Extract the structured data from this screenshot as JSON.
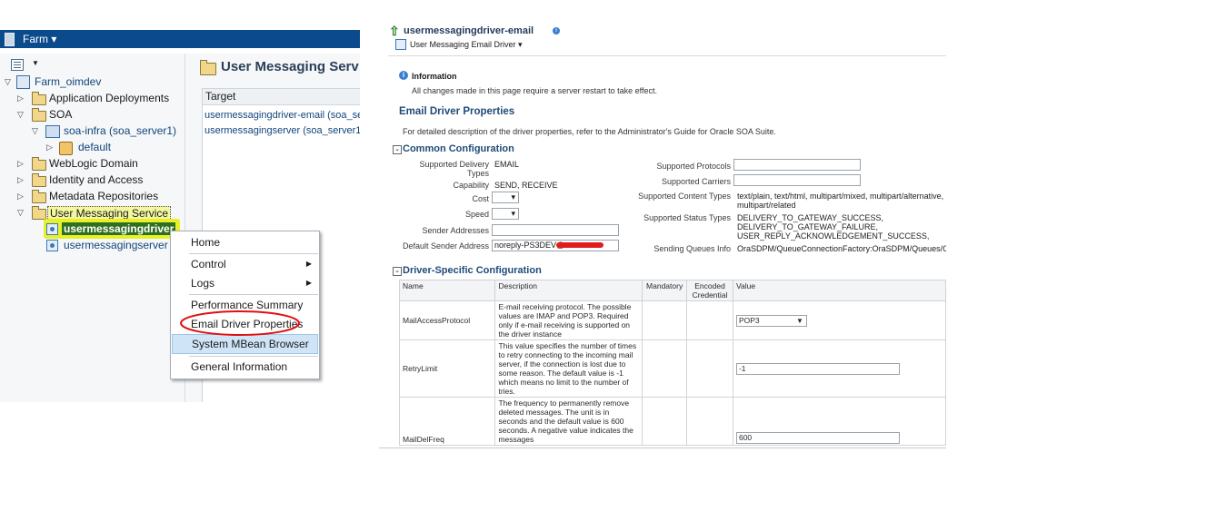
{
  "left_panel": {
    "farm_menu": "Farm",
    "tree": {
      "root": "Farm_oimdev",
      "items": [
        {
          "label": "Application Deployments"
        },
        {
          "label": "SOA"
        },
        {
          "label": "soa-infra (soa_server1)"
        },
        {
          "label": "default"
        },
        {
          "label": "WebLogic Domain"
        },
        {
          "label": "Identity and Access"
        },
        {
          "label": "Metadata Repositories"
        },
        {
          "label": "User Messaging Service"
        },
        {
          "label": "usermessagingdriver"
        },
        {
          "label": "usermessagingserver (s"
        }
      ]
    },
    "content_title": "User Messaging Serv",
    "table_header": "Target",
    "targets": [
      "usermessagingdriver-email (soa_se",
      "usermessagingserver (soa_server1)"
    ],
    "context_menu": {
      "items": [
        "Home",
        "Control",
        "Logs",
        "Performance Summary",
        "Email Driver Properties",
        "System MBean Browser",
        "General Information"
      ]
    }
  },
  "right_panel": {
    "title": "usermessagingdriver-email",
    "driver_menu": "User Messaging Email Driver",
    "info_heading": "Information",
    "info_text": "All changes made in this page require a server restart to take effect.",
    "page_heading": "Email Driver Properties",
    "page_desc": "For detailed description of the driver properties, refer to the Administrator's Guide for Oracle SOA Suite.",
    "common": {
      "heading": "Common Configuration",
      "delivery_label1": "Supported Delivery",
      "delivery_label2": "Types",
      "delivery_value": "EMAIL",
      "capability_label": "Capability",
      "capability_value": "SEND, RECEIVE",
      "cost_label": "Cost",
      "speed_label": "Speed",
      "sender_addresses_label": "Sender Addresses",
      "default_sender_label": "Default Sender Address",
      "default_sender_value": "noreply-PS3DEV@",
      "protocols_label": "Supported Protocols",
      "carriers_label": "Supported Carriers",
      "content_types_label": "Supported Content Types",
      "content_types_value1": "text/plain, text/html, multipart/mixed, multipart/alternative,",
      "content_types_value2": "multipart/related",
      "status_types_label": "Supported Status Types",
      "status_value1": "DELIVERY_TO_GATEWAY_SUCCESS,",
      "status_value2": "DELIVERY_TO_GATEWAY_FAILURE,",
      "status_value3": "USER_REPLY_ACKNOWLEDGEMENT_SUCCESS,",
      "queues_label": "Sending Queues Info",
      "queues_value": "OraSDPM/QueueConnectionFactory:OraSDPM/Queues/OraSD"
    },
    "driver_specific": {
      "heading": "Driver-Specific Configuration",
      "columns": {
        "name": "Name",
        "description": "Description",
        "mandatory": "Mandatory",
        "encoded1": "Encoded",
        "encoded2": "Credential",
        "value": "Value"
      },
      "rows": [
        {
          "name": "MailAccessProtocol",
          "desc": "E-mail receiving protocol. The possible values are IMAP and POP3. Required only if e-mail receiving is supported on the driver instance",
          "value": "POP3"
        },
        {
          "name": "RetryLimit",
          "desc": "This value specifies the number of times to retry connecting to the incoming mail server, if the connection is lost due to some reason. The default value is -1 which means no limit to the number of tries.",
          "value": "-1"
        },
        {
          "name": "MailDelFreq",
          "desc": "The frequency to permanently remove deleted messages. The unit is in seconds and the default value is 600 seconds. A negative value indicates the messages",
          "value": "600"
        }
      ]
    }
  },
  "colors": {
    "farm_bar": "#0b4a8c",
    "highlight": "#e8f02a",
    "menu_hover": "#cfe5f7",
    "link": "#12457a",
    "circle": "#e01010"
  }
}
